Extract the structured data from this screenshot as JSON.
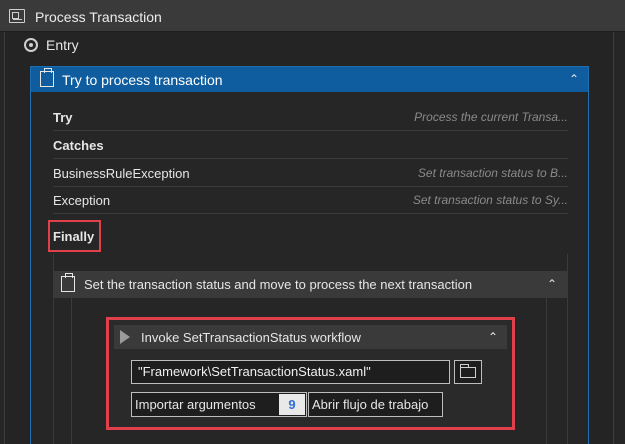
{
  "window": {
    "title": "Process Transaction",
    "title_icon": "workflow-window-icon"
  },
  "state": {
    "label": "Entry",
    "icon": "state-entry-icon"
  },
  "try_catch": {
    "header": "Try to process transaction",
    "header_icon": "try-catch-icon",
    "collapse_icon": "chevron-double-up-icon",
    "try_label": "Try",
    "try_hint": "Process the current Transa...",
    "catches_label": "Catches",
    "catches": [
      {
        "exception": "BusinessRuleException",
        "hint": "Set transaction status to B..."
      },
      {
        "exception": "Exception",
        "hint": "Set transaction status to Sy..."
      }
    ],
    "finally_label": "Finally"
  },
  "sequence": {
    "header": "Set the transaction status and move to process the next transaction",
    "header_icon": "sequence-icon",
    "collapse_icon": "chevron-double-up-icon"
  },
  "invoke": {
    "header": "Invoke SetTransactionStatus workflow",
    "header_icon": "invoke-workflow-icon",
    "collapse_icon": "chevron-double-up-icon",
    "file_path": "\"Framework\\SetTransactionStatus.xaml\"",
    "browse_icon": "folder-icon",
    "import_label": "Importar argumentos",
    "import_count": "9",
    "open_label": "Abrir flujo de trabajo"
  },
  "colors": {
    "highlight": "#e0404a",
    "accent": "#0f5c9e",
    "count": "#2f6fd6"
  }
}
